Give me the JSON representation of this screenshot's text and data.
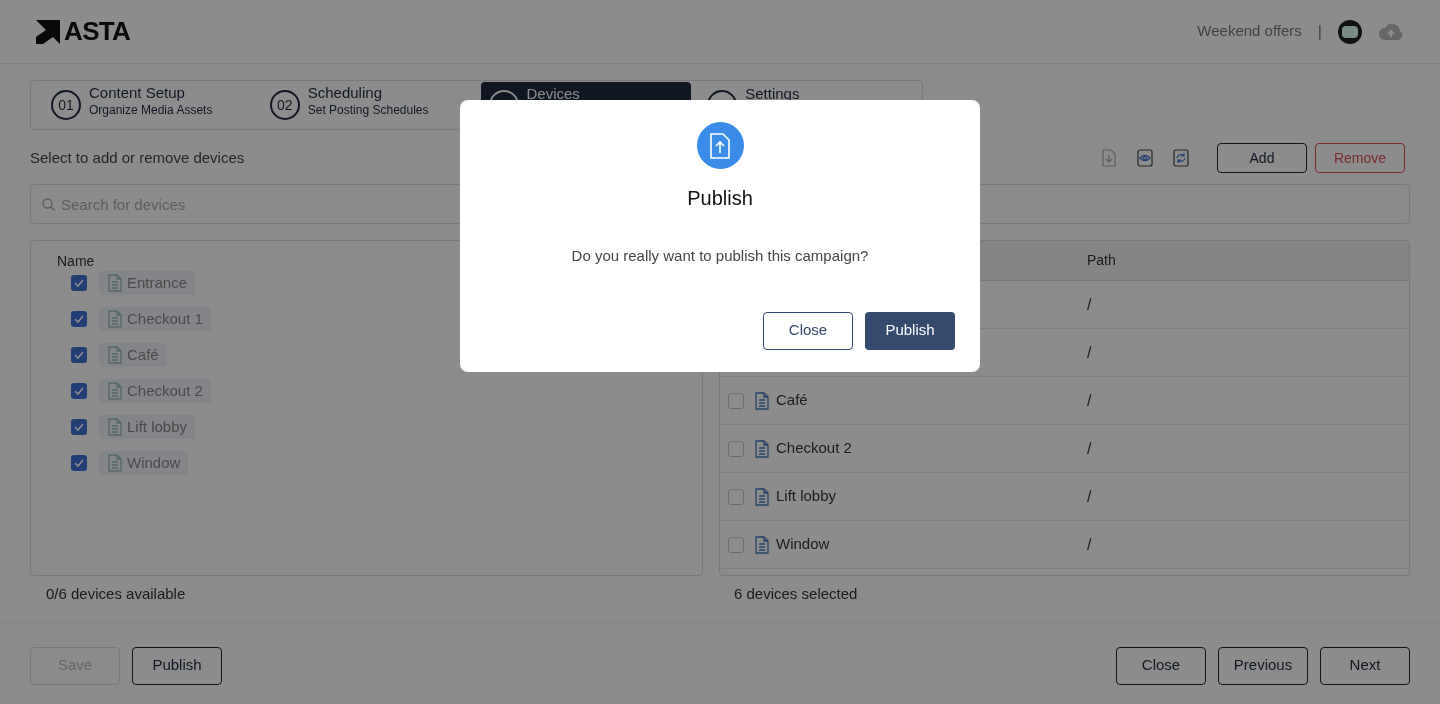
{
  "header": {
    "logo": "ASTA",
    "campaign": "Weekend offers",
    "separator": "|"
  },
  "steps": [
    {
      "number": "01",
      "title": "Content Setup",
      "subtitle": "Organize Media Assets",
      "selected": false
    },
    {
      "number": "02",
      "title": "Scheduling",
      "subtitle": "Set Posting Schedules",
      "selected": false
    },
    {
      "title": "Devices",
      "selected": true
    },
    {
      "title": "Settings",
      "selected": false
    }
  ],
  "instruction": "Select to add or remove devices",
  "toolbar": {
    "buttons": [
      {
        "label": "Add",
        "kind": "primary"
      },
      {
        "label": "Remove",
        "kind": "danger"
      }
    ]
  },
  "search": {
    "placeholder": "Search for devices"
  },
  "available": {
    "column": "Name",
    "items": [
      {
        "name": "Entrance",
        "checked": true
      },
      {
        "name": "Checkout 1",
        "checked": true
      },
      {
        "name": "Café",
        "checked": true
      },
      {
        "name": "Checkout 2",
        "checked": true
      },
      {
        "name": "Lift lobby",
        "checked": true
      },
      {
        "name": "Window",
        "checked": true
      }
    ],
    "footer": "0/6 devices available"
  },
  "selected_table": {
    "columns": [
      "Path"
    ],
    "rows": [
      {
        "path": "/"
      },
      {
        "path": "/"
      },
      {
        "name": "Café",
        "path": "/",
        "checked": false
      },
      {
        "name": "Checkout 2",
        "path": "/",
        "checked": false
      },
      {
        "name": "Lift lobby",
        "path": "/",
        "checked": false
      },
      {
        "name": "Window",
        "path": "/",
        "checked": false
      }
    ],
    "footer": "6 devices selected"
  },
  "footer_bar": {
    "left": [
      {
        "label": "Save",
        "disabled": true
      },
      {
        "label": "Publish",
        "disabled": false
      }
    ],
    "right": [
      {
        "label": "Close",
        "disabled": false
      },
      {
        "label": "Previous",
        "disabled": false
      },
      {
        "label": "Next",
        "disabled": false
      }
    ]
  },
  "dialog": {
    "title": "Publish",
    "message": "Do you really want to publish this campaign?",
    "buttons": [
      {
        "label": "Close",
        "kind": "secondary"
      },
      {
        "label": "Publish",
        "kind": "primary"
      }
    ]
  }
}
